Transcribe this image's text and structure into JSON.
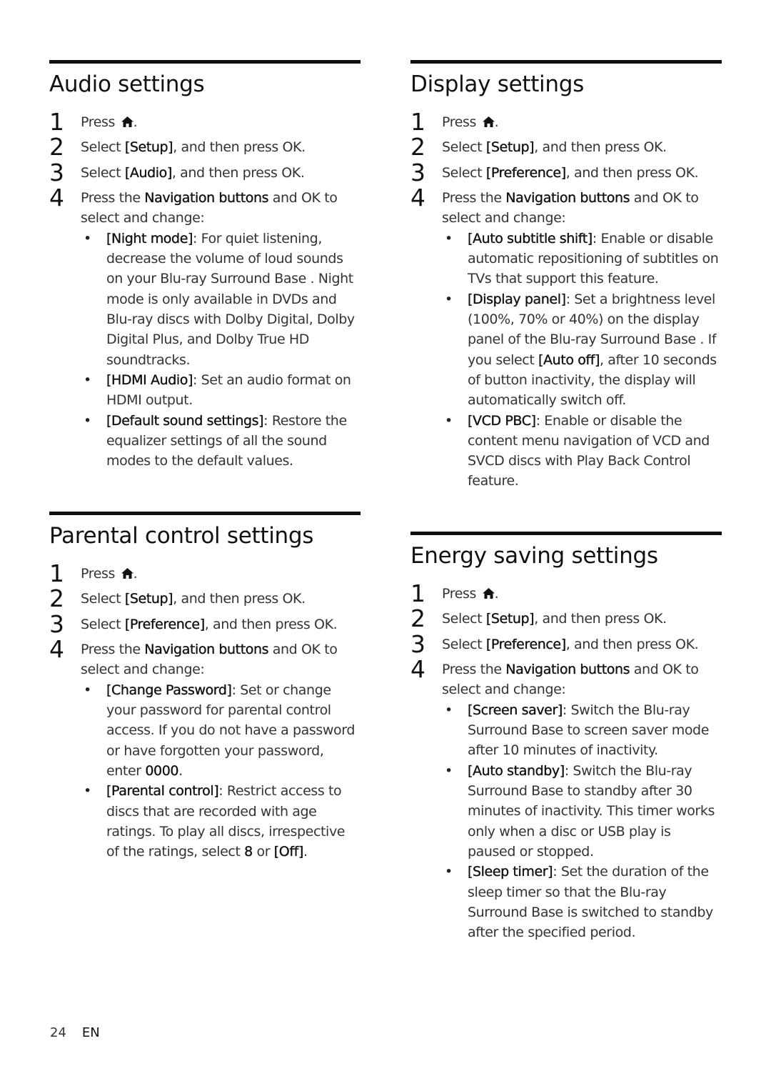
{
  "page": {
    "page_number": "24",
    "language": "EN"
  },
  "sections": {
    "audio": {
      "title": "Audio settings",
      "steps": [
        {
          "num": "1",
          "pre": "Press ",
          "icon": "home-icon",
          "post": "."
        },
        {
          "num": "2",
          "pre": "Select ",
          "bold": "[Setup]",
          "post": ", and then press OK."
        },
        {
          "num": "3",
          "pre": "Select ",
          "bold": "[Audio]",
          "post": ", and then press OK."
        },
        {
          "num": "4",
          "pre": "Press the ",
          "bold": "Navigation buttons",
          "post": " and OK to select and change:"
        }
      ],
      "bullets": [
        {
          "term": "[Night mode]",
          "text": ": For quiet listening, decrease the volume of loud sounds on your Blu-ray Surround Base . Night mode is only available in DVDs and Blu-ray discs with Dolby Digital, Dolby Digital Plus, and Dolby True HD soundtracks."
        },
        {
          "term": "[HDMI Audio]",
          "text": ": Set an audio format on HDMI output."
        },
        {
          "term": "[Default sound settings]",
          "text": ": Restore the equalizer settings of all the sound modes to the default values."
        }
      ]
    },
    "parental": {
      "title": "Parental control settings",
      "steps": [
        {
          "num": "1",
          "pre": "Press ",
          "icon": "home-icon",
          "post": "."
        },
        {
          "num": "2",
          "pre": "Select ",
          "bold": "[Setup]",
          "post": ", and then press OK."
        },
        {
          "num": "3",
          "pre": "Select ",
          "bold": "[Preference]",
          "post": ", and then press OK."
        },
        {
          "num": "4",
          "pre": "Press the ",
          "bold": "Navigation buttons",
          "post": " and OK to select and change:"
        }
      ],
      "bullets": [
        {
          "term": "[Change Password]",
          "text": ": Set or change your password for parental control access. If you do not have a password or have forgotten your password, enter ",
          "term2": "0000",
          "text2": "."
        },
        {
          "term": "[Parental control]",
          "text": ": Restrict access to discs that are recorded with age ratings. To play all discs, irrespective of the ratings, select ",
          "term2": "8",
          "text2": " or ",
          "term3": "[Off]",
          "text3": "."
        }
      ]
    },
    "display": {
      "title": "Display settings",
      "steps": [
        {
          "num": "1",
          "pre": "Press ",
          "icon": "home-icon",
          "post": "."
        },
        {
          "num": "2",
          "pre": "Select ",
          "bold": "[Setup]",
          "post": ", and then press OK."
        },
        {
          "num": "3",
          "pre": "Select ",
          "bold": "[Preference]",
          "post": ", and then press OK."
        },
        {
          "num": "4",
          "pre": "Press the ",
          "bold": "Navigation buttons",
          "post": " and OK to select and change:"
        }
      ],
      "bullets": [
        {
          "term": "[Auto subtitle shift]",
          "text": ": Enable or disable automatic repositioning of subtitles on TVs that support this feature."
        },
        {
          "term": "[Display panel]",
          "text": ": Set a brightness level (100%, 70% or 40%) on the display panel of the Blu-ray Surround Base . If you select ",
          "term2": "[Auto off]",
          "text2": ", after 10 seconds of button inactivity, the display will automatically switch off."
        },
        {
          "term": "[VCD PBC]",
          "text": ": Enable or disable the content menu navigation of VCD and SVCD discs with Play Back Control feature."
        }
      ]
    },
    "energy": {
      "title": "Energy saving settings",
      "steps": [
        {
          "num": "1",
          "pre": "Press ",
          "icon": "home-icon",
          "post": "."
        },
        {
          "num": "2",
          "pre": "Select ",
          "bold": "[Setup]",
          "post": ", and then press OK."
        },
        {
          "num": "3",
          "pre": "Select ",
          "bold": "[Preference]",
          "post": ", and then press OK."
        },
        {
          "num": "4",
          "pre": "Press the ",
          "bold": "Navigation buttons",
          "post": " and OK to select and change:"
        }
      ],
      "bullets": [
        {
          "term": "[Screen saver]",
          "text": ": Switch the Blu-ray Surround Base  to screen saver mode after 10 minutes of inactivity."
        },
        {
          "term": "[Auto standby]",
          "text": ": Switch the Blu-ray Surround Base  to standby after 30 minutes of inactivity. This timer works only when a disc or USB play is paused or stopped."
        },
        {
          "term": "[Sleep timer]",
          "text": ": Set the duration of the sleep timer so that the Blu-ray Surround Base  is switched to standby after the specified period."
        }
      ]
    }
  }
}
